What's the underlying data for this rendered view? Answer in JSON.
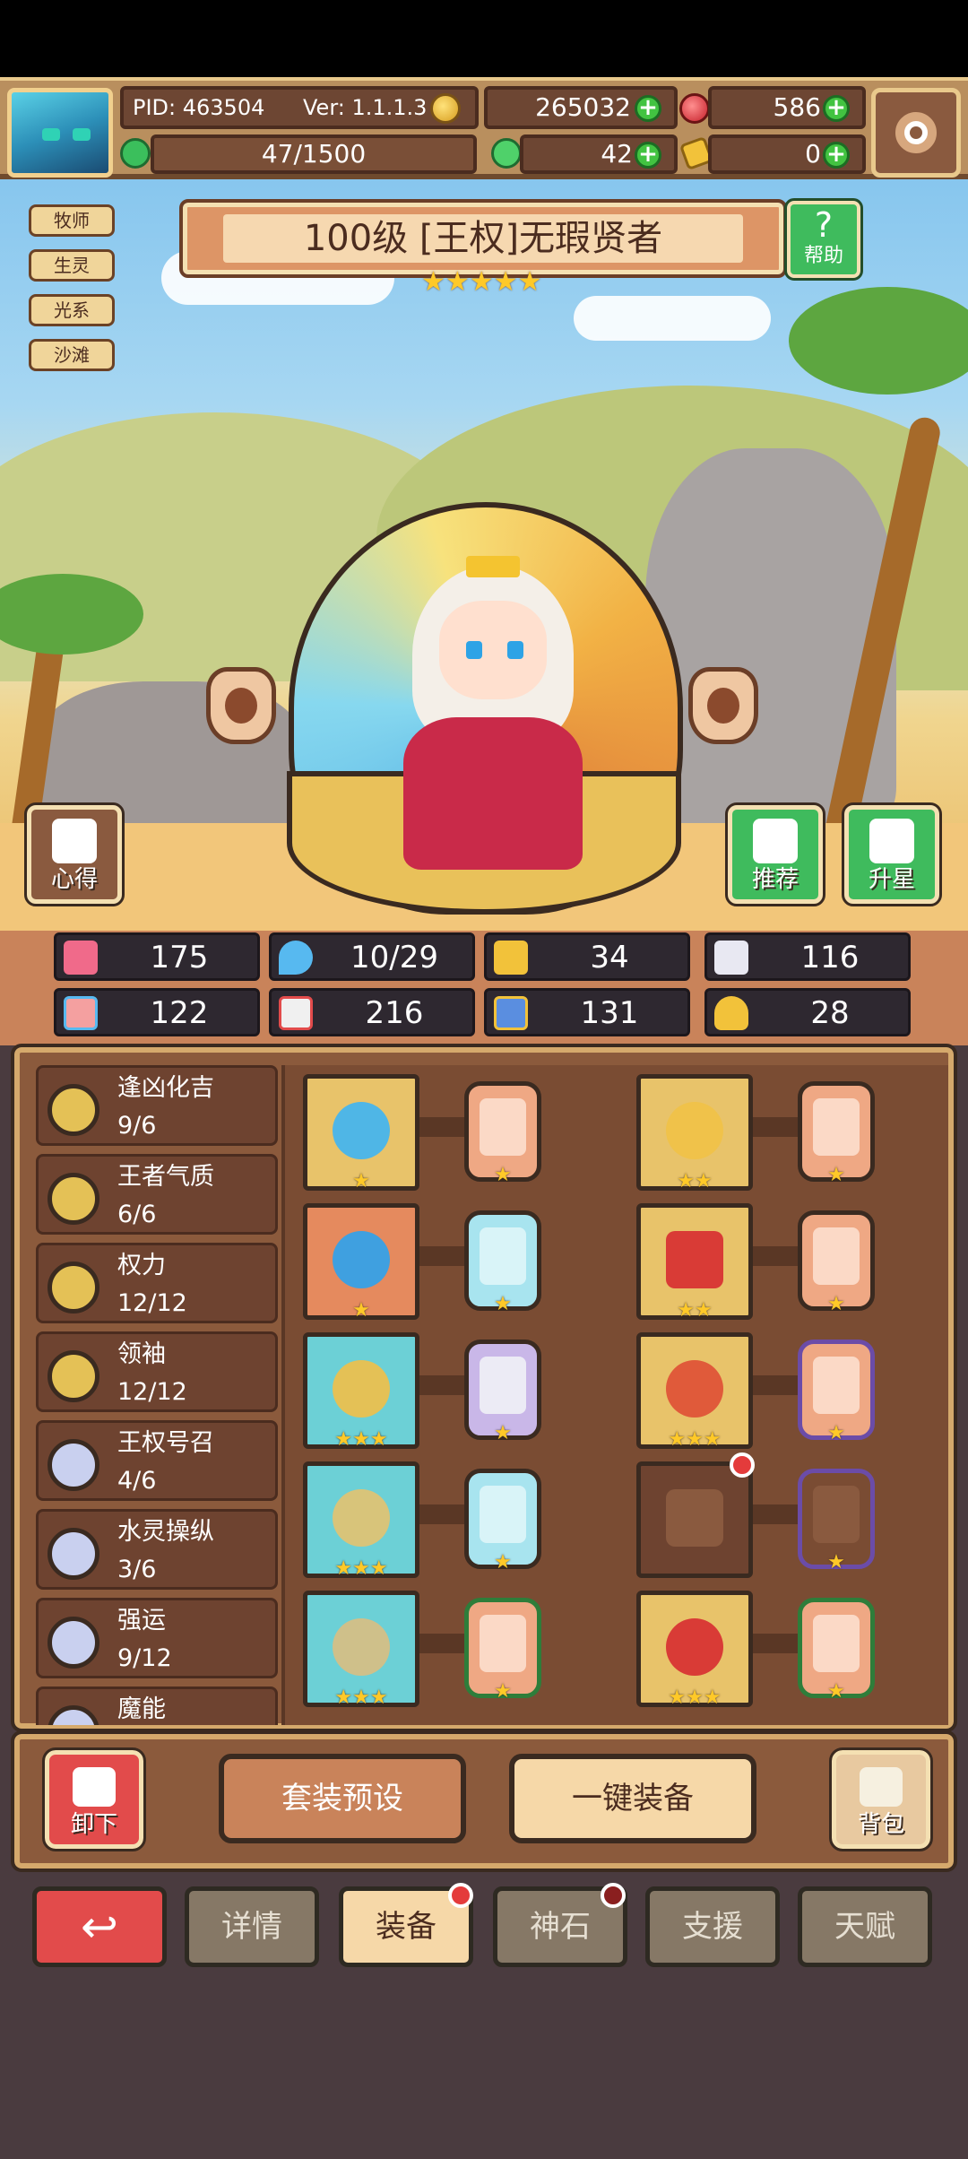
{
  "header": {
    "pid": "PID: 463504",
    "version": "Ver: 1.1.1.3",
    "gold": "265032",
    "gems": "586",
    "stamina": "47/1500",
    "clover": "42",
    "pointer": "0"
  },
  "tags": [
    "牧师",
    "生灵",
    "光系",
    "沙滩"
  ],
  "hero": {
    "title": "100级 [王权]无瑕贤者",
    "stars": "★★★★★",
    "help_label": "帮助"
  },
  "scene_buttons": {
    "tips": "心得",
    "recommend": "推荐",
    "star_up": "升星"
  },
  "stats": [
    "175",
    "10/29",
    "34",
    "116",
    "122",
    "216",
    "131",
    "28"
  ],
  "sets": [
    {
      "name": "逢凶化吉",
      "count": "9/6"
    },
    {
      "name": "王者气质",
      "count": "6/6"
    },
    {
      "name": "权力",
      "count": "12/12"
    },
    {
      "name": "领袖",
      "count": "12/12"
    },
    {
      "name": "王权号召",
      "count": "4/6"
    },
    {
      "name": "水灵操纵",
      "count": "3/6"
    },
    {
      "name": "强运",
      "count": "9/12"
    },
    {
      "name": "魔能",
      "count": ""
    }
  ],
  "slot_stars": {
    "s1": "★",
    "s2": "★★",
    "s3": "★",
    "s4": "★★",
    "s5": "★★★",
    "s6": "★★★",
    "s7": "★★★",
    "s8": "",
    "s9": "★★★",
    "s10": "★★★",
    "c1": "★",
    "c2": "★",
    "c3": "★",
    "c4": "★",
    "c5": "★",
    "c6": "★",
    "c7": "★",
    "c8": "★",
    "c9": "★",
    "c10": "★"
  },
  "actions": {
    "unequip": "卸下",
    "preset": "套装预设",
    "auto_equip": "一键装备",
    "bag": "背包"
  },
  "tabs": [
    "详情",
    "装备",
    "神石",
    "支援",
    "天赋"
  ],
  "colors": {
    "gold_accent": "#ffc928",
    "green_button": "#3fbb5d",
    "red_button": "#e24b4b",
    "panel_brown": "#8b5a3c"
  }
}
